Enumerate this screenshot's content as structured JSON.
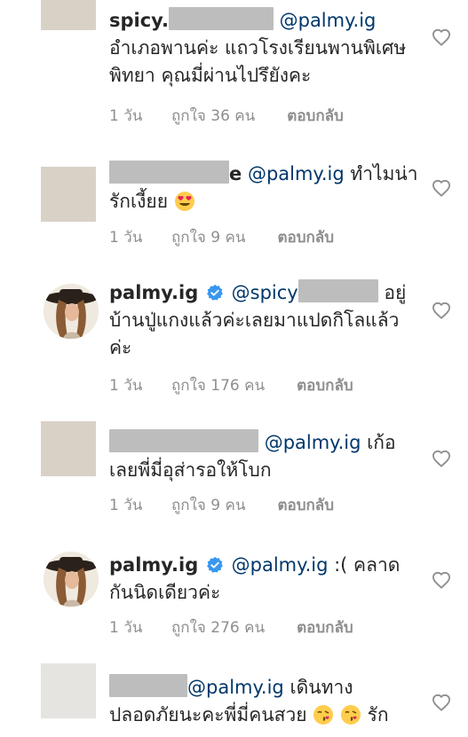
{
  "comments": [
    {
      "username": "spicy.",
      "mention": "@palmy.ig",
      "text1": " อำเภอพานค่ะ แถวโรงเรียนพานพิเศษพิทยา คุณมี่ผ่านไปรึยังคะ",
      "time": "1 วัน",
      "likes": "ถูกใจ 36 คน",
      "reply": "ตอบกลับ"
    },
    {
      "username": "e",
      "mention": "@palmy.ig",
      "text1": " ทำไมน่ารักเงี้ยย",
      "emoji": "heart-eyes-emoji",
      "time": "1 วัน",
      "likes": "ถูกใจ 9 คน",
      "reply": "ตอบกลับ"
    },
    {
      "username": "palmy.ig",
      "mention": "@spicy",
      "text1": "อยู่บ้านปู่แกงแล้วค่ะเลยมาแปดกิโลแล้วค่ะ",
      "time": "1 วัน",
      "likes": "ถูกใจ 176 คน",
      "reply": "ตอบกลับ"
    },
    {
      "username": "",
      "mention": "@palmy.ig",
      "text1": " เก้อเลยพี่มี่อุส่ารอให้โบก",
      "time": "1 วัน",
      "likes": "ถูกใจ 9 คน",
      "reply": "ตอบกลับ"
    },
    {
      "username": "palmy.ig",
      "mention": "@palmy.ig",
      "text1": " :( คลาดกันนิดเดียวค่ะ",
      "time": "1 วัน",
      "likes": "ถูกใจ 276 คน",
      "reply": "ตอบกลับ"
    },
    {
      "username": "",
      "mention": "@palmy.ig",
      "text1": " เดินทางปลอดภัยนะคะพี่มี่คนสวย",
      "text2": "รัก",
      "emoji": "kiss-emoji",
      "time": "",
      "likes": "",
      "reply": ""
    }
  ],
  "colors": {
    "text": "#262626",
    "meta": "#8e8e8e",
    "mention": "#00376b",
    "verified": "#3897f0"
  }
}
